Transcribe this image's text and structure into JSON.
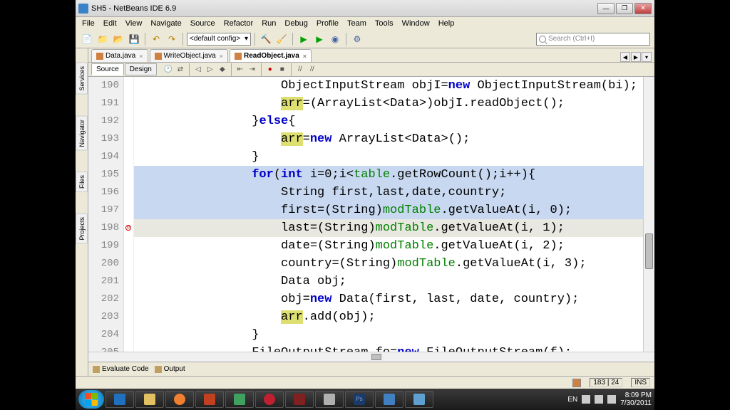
{
  "titlebar": {
    "title": "SH5 - NetBeans IDE 6.9"
  },
  "menu": [
    "File",
    "Edit",
    "View",
    "Navigate",
    "Source",
    "Refactor",
    "Run",
    "Debug",
    "Profile",
    "Team",
    "Tools",
    "Window",
    "Help"
  ],
  "config": {
    "label": "<default config>"
  },
  "search": {
    "placeholder": "Search (Ctrl+I)"
  },
  "sidetabs": [
    "Services",
    "Navigator",
    "Files",
    "Projects"
  ],
  "filetabs": [
    {
      "label": "Data.java",
      "active": false
    },
    {
      "label": "WriteObject.java",
      "active": false
    },
    {
      "label": "ReadObject.java",
      "active": true
    }
  ],
  "subtabs": {
    "source": "Source",
    "design": "Design"
  },
  "lines": [
    {
      "n": 190,
      "html": "                    ObjectInputStream objI=<span class='kw'>new</span> ObjectInputStream(bi);"
    },
    {
      "n": 191,
      "html": "                    <span class='hl'>arr</span>=(ArrayList&lt;Data&gt;)objI.readObject();"
    },
    {
      "n": 192,
      "html": "                }<span class='kw'>else</span>{"
    },
    {
      "n": 193,
      "html": "                    <span class='hl'>arr</span>=<span class='kw'>new</span> ArrayList&lt;Data&gt;();"
    },
    {
      "n": 194,
      "html": "                }"
    },
    {
      "n": 195,
      "html": "                <span class='kw'>for</span>(<span class='kw'>int</span> i=0;i&lt;<span class='id'>table</span>.getRowCount();i++){",
      "sel": true
    },
    {
      "n": 196,
      "html": "                    String first,last,date,country;",
      "sel": true
    },
    {
      "n": 197,
      "html": "                    first=(String)<span class='id'>modTable</span>.getValueAt(i, 0);",
      "sel": true
    },
    {
      "n": 198,
      "html": "                    last=(String)<span class='id'>modTable</span>.getValueAt(i, 1);",
      "cur": true,
      "error": true
    },
    {
      "n": 199,
      "html": "                    date=(String)<span class='id'>modTable</span>.getValueAt(i, 2);"
    },
    {
      "n": 200,
      "html": "                    country=(String)<span class='id'>modTable</span>.getValueAt(i, 3);"
    },
    {
      "n": 201,
      "html": "                    Data obj;"
    },
    {
      "n": 202,
      "html": "                    obj=<span class='kw'>new</span> Data(first, last, date, country);"
    },
    {
      "n": 203,
      "html": "                    <span class='hl'>arr</span>.add(obj);"
    },
    {
      "n": 204,
      "html": "                }"
    },
    {
      "n": 205,
      "html": "                FileOutputStream fo=<span class='kw'>new</span> FileOutputStream(f);"
    }
  ],
  "bottom": {
    "evaluate": "Evaluate Code",
    "output": "Output"
  },
  "status": {
    "warnicon": true,
    "cursor": "183 | 24",
    "mode": "INS"
  },
  "tray": {
    "lang": "EN",
    "time": "8:09 PM",
    "date": "7/30/2011"
  }
}
